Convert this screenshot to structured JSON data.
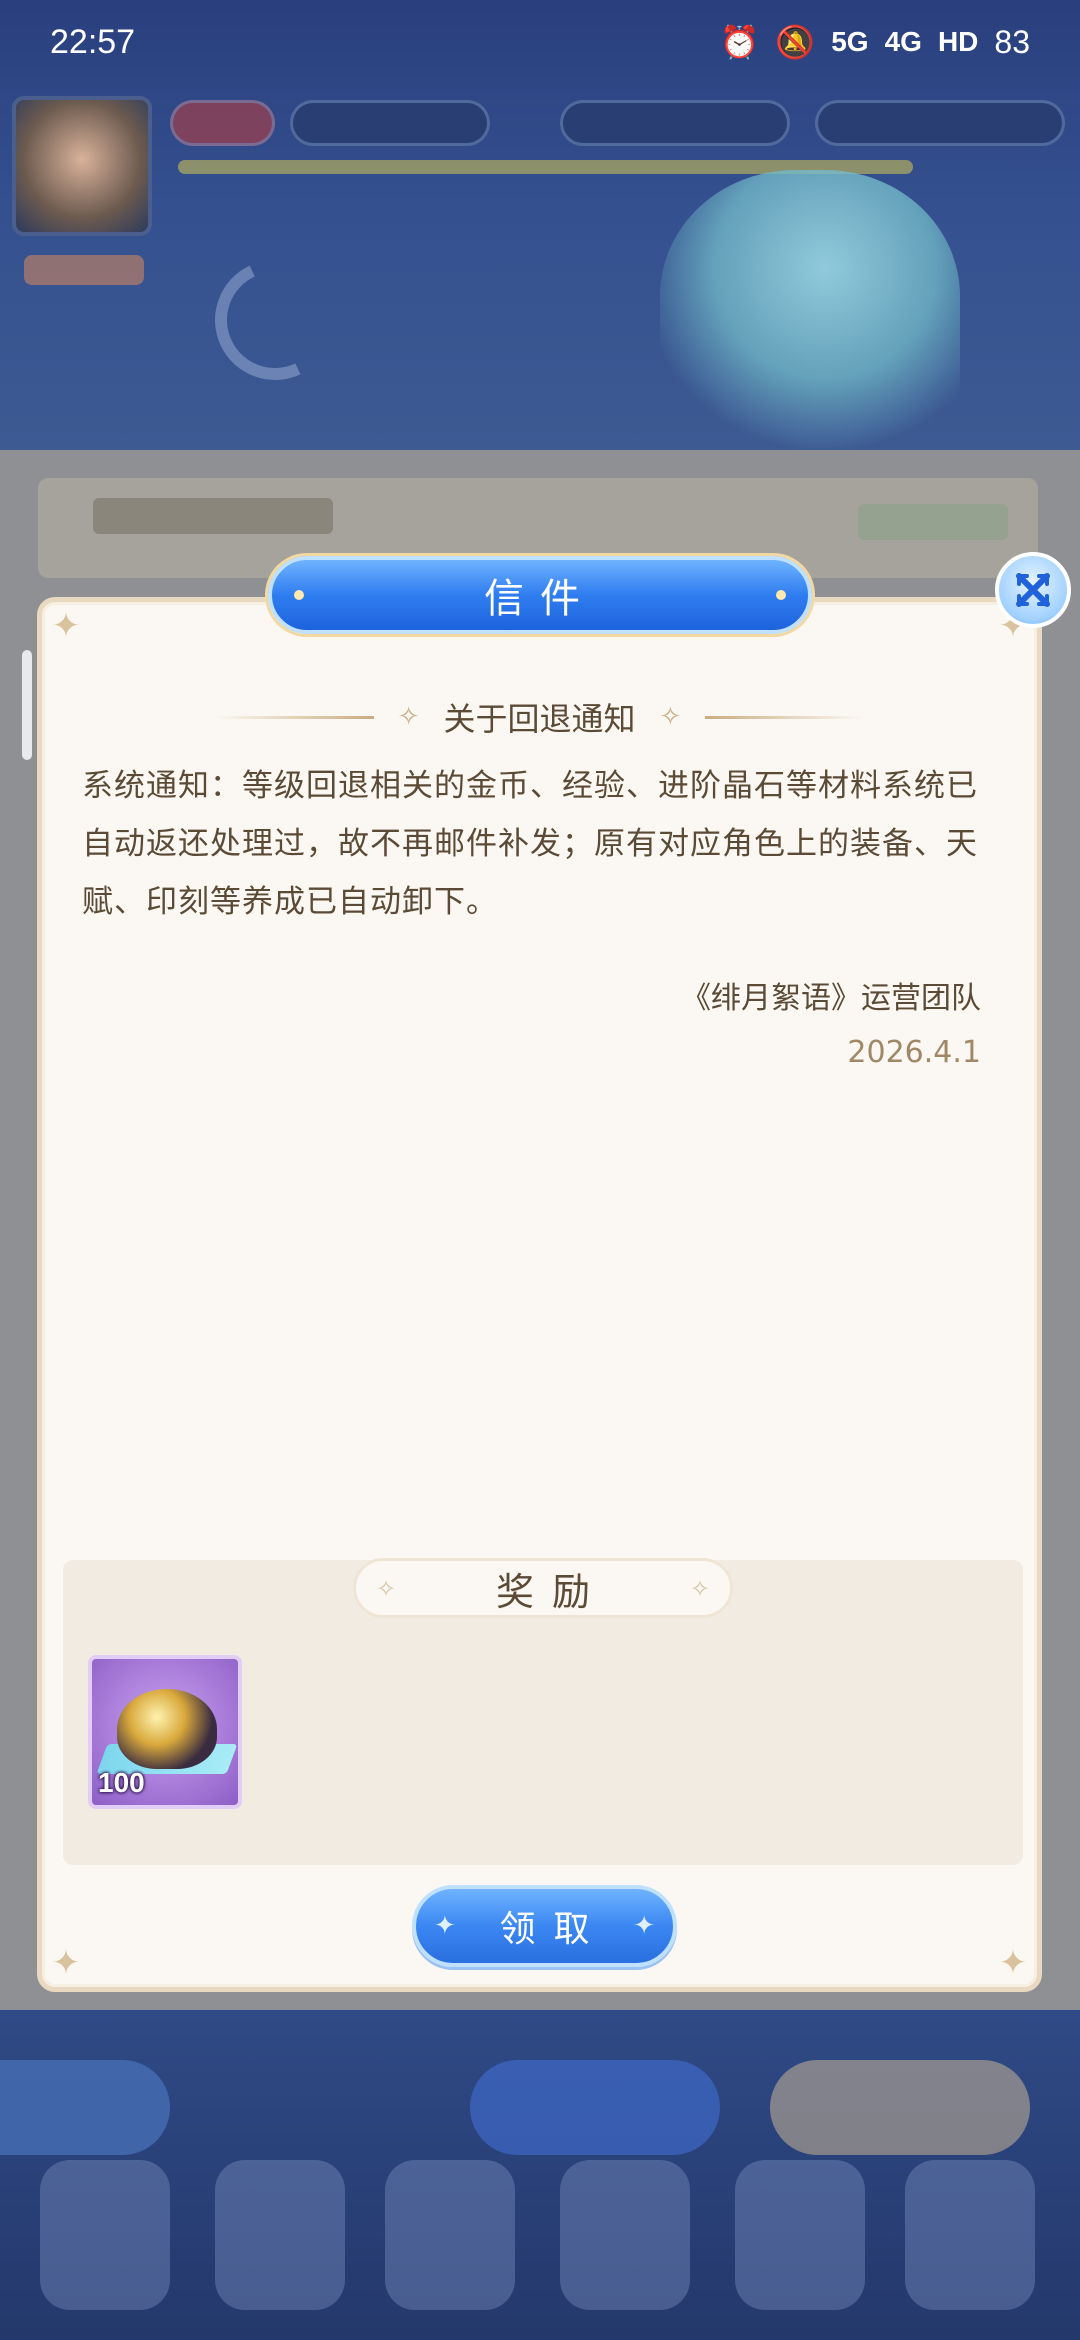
{
  "status_bar": {
    "time": "22:57",
    "signal_labels": [
      "5G",
      "4G",
      "HD"
    ],
    "battery": "83"
  },
  "dialog": {
    "title": "信件",
    "subject": "关于回退通知",
    "body": "系统通知：等级回退相关的金币、经验、进阶晶石等材料系统已自动返还处理过，故不再邮件补发；原有对应角色上的装备、天赋、印刻等养成已自动卸下。",
    "signature": "《绯月絮语》运营团队",
    "date": "2026.4.1",
    "reward_title": "奖励",
    "rewards": [
      {
        "icon": "gold-crystal-ore-icon",
        "count": "100"
      }
    ],
    "claim_label": "领取"
  },
  "colors": {
    "accent_blue": "#2f7df0",
    "text_brown": "#5b4a36",
    "paper": "#fbf8f3"
  }
}
